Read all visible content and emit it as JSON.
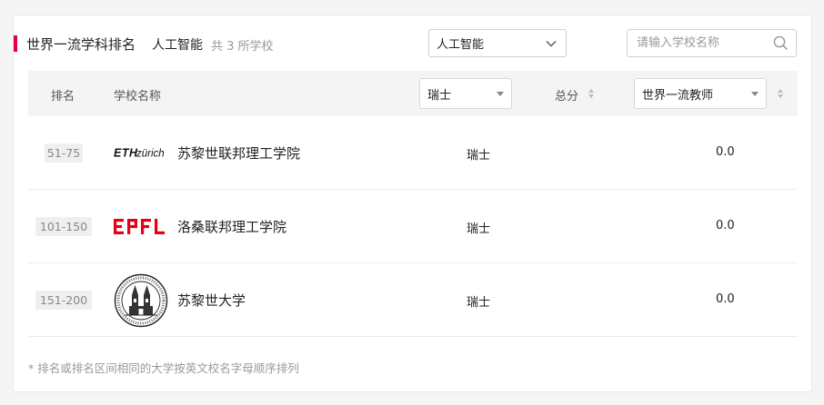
{
  "header": {
    "title": "世界一流学科排名",
    "subject": "人工智能",
    "count_text": "共 3 所学校"
  },
  "subject_select": {
    "value": "人工智能"
  },
  "search": {
    "placeholder": "请输入学校名称"
  },
  "table_header": {
    "rank": "排名",
    "school": "学校名称",
    "country_filter": "瑞士",
    "total_score": "总分",
    "indicator_filter": "世界一流教师"
  },
  "rows": [
    {
      "rank": "51-75",
      "logo_text": "ETHzürich",
      "name": "苏黎世联邦理工学院",
      "country": "瑞士",
      "score": "0.0"
    },
    {
      "rank": "101-150",
      "logo_text": "EPFL",
      "name": "洛桑联邦理工学院",
      "country": "瑞士",
      "score": "0.0"
    },
    {
      "rank": "151-200",
      "logo_text": "",
      "name": "苏黎世大学",
      "country": "瑞士",
      "score": "0.0"
    }
  ],
  "footnote": "* 排名或排名区间相同的大学按英文校名字母顺序排列",
  "colors": {
    "accent": "#e0003c",
    "epfl_red": "#e2001a",
    "header_bg": "#f4f4f4"
  },
  "icons": [
    "chevron-down-icon",
    "search-icon",
    "caret-down-icon",
    "sort-icon",
    "uzh-seal-icon"
  ]
}
